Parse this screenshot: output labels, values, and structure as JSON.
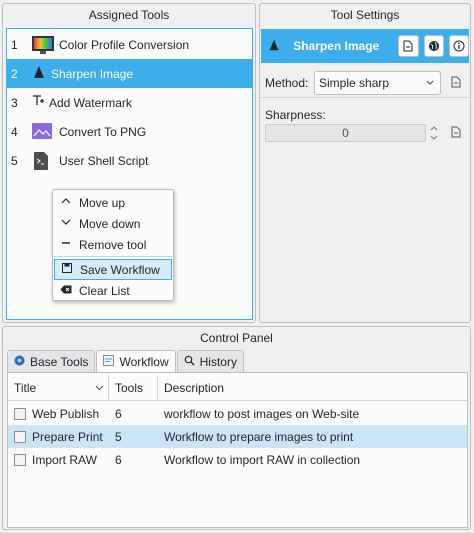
{
  "assigned_tools": {
    "title": "Assigned Tools",
    "items": [
      {
        "num": "1",
        "label": "Color Profile Conversion",
        "icon": "color-profile-icon"
      },
      {
        "num": "2",
        "label": "Sharpen Image",
        "icon": "sharpen-icon"
      },
      {
        "num": "3",
        "label": "Add Watermark",
        "icon": "watermark-icon"
      },
      {
        "num": "4",
        "label": "Convert To PNG",
        "icon": "png-convert-icon"
      },
      {
        "num": "5",
        "label": "User Shell Script",
        "icon": "shell-script-icon"
      }
    ]
  },
  "context_menu": {
    "items": [
      {
        "label": "Move up",
        "icon": "chevron-up-icon"
      },
      {
        "label": "Move down",
        "icon": "chevron-down-icon"
      },
      {
        "label": "Remove tool",
        "icon": "minus-icon"
      },
      {
        "label": "Save Workflow",
        "icon": "save-icon"
      },
      {
        "label": "Clear List",
        "icon": "clear-icon"
      }
    ]
  },
  "tool_settings": {
    "title": "Tool Settings",
    "header_title": "Sharpen Image",
    "method_label": "Method:",
    "method_value": "Simple sharp",
    "sharpness_label": "Sharpness:",
    "sharpness_value": "0"
  },
  "control_panel": {
    "title": "Control Panel",
    "tabs": [
      {
        "label": "Base Tools",
        "icon": "base-tools-icon"
      },
      {
        "label": "Workflow",
        "icon": "workflow-icon"
      },
      {
        "label": "History",
        "icon": "history-icon"
      }
    ],
    "columns": [
      "Title",
      "Tools",
      "Description"
    ],
    "rows": [
      {
        "title": "Web Publish",
        "tools": "6",
        "description": "workflow to post images on Web-site"
      },
      {
        "title": "Prepare Print",
        "tools": "5",
        "description": "Workflow to prepare images to print"
      },
      {
        "title": "Import RAW",
        "tools": "6",
        "description": "Workflow to import RAW in collection"
      }
    ]
  },
  "colors": {
    "accent": "#3daee9",
    "selection_light": "#c9e5f6",
    "background": "#eff0f1"
  }
}
